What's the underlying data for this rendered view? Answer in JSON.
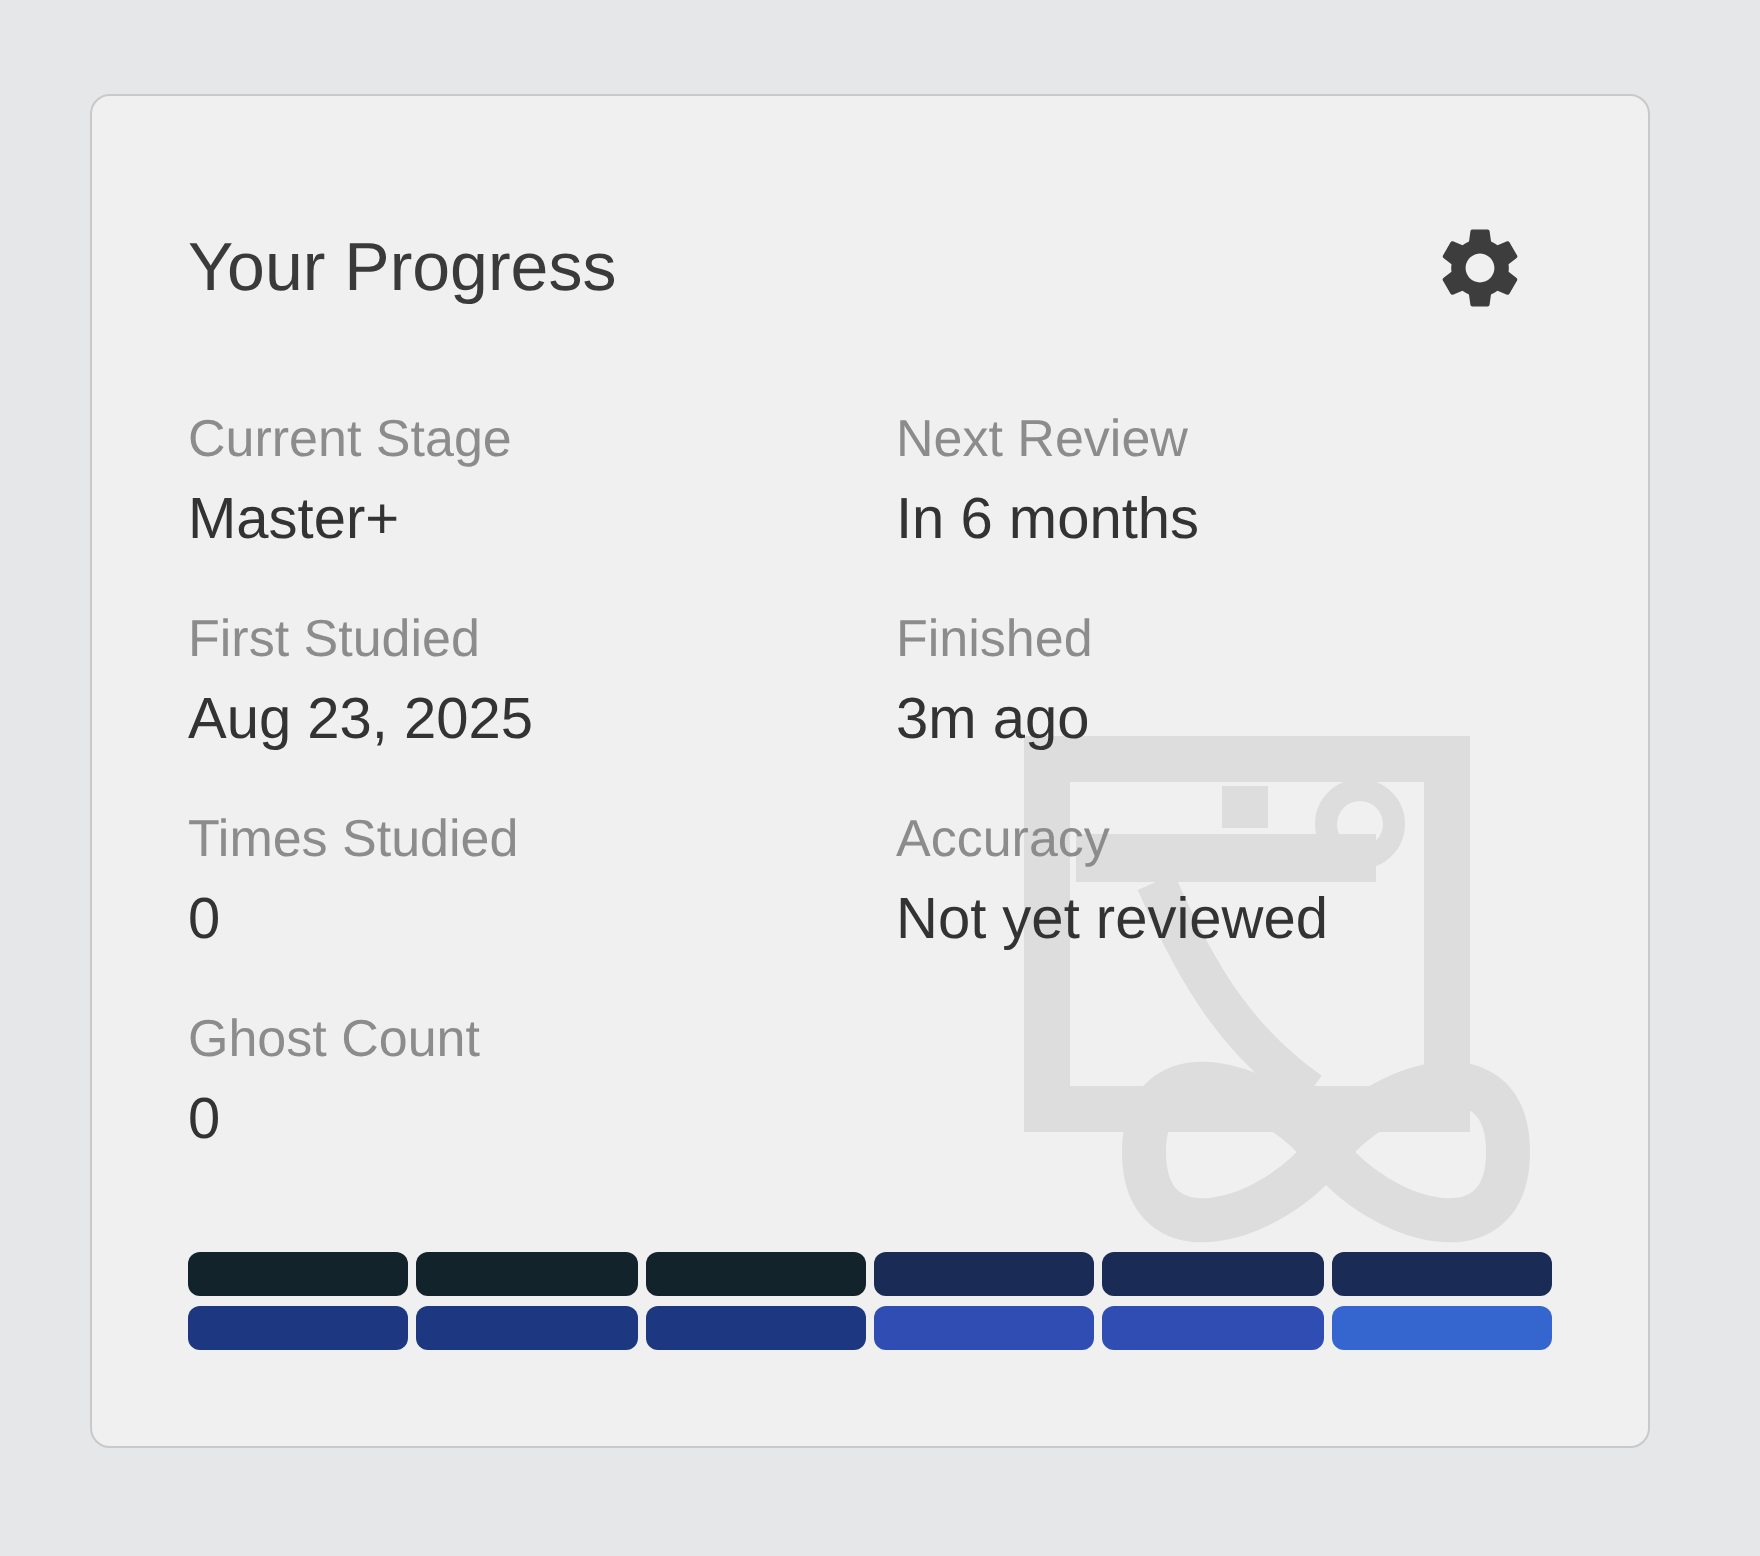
{
  "card": {
    "title": "Your Progress"
  },
  "stats": [
    {
      "label": "Current Stage",
      "value": "Master+"
    },
    {
      "label": "Next Review",
      "value": "In 6 months"
    },
    {
      "label": "First Studied",
      "value": "Aug 23, 2025"
    },
    {
      "label": "Finished",
      "value": "3m ago"
    },
    {
      "label": "Times Studied",
      "value": "0"
    },
    {
      "label": "Accuracy",
      "value": "Not yet reviewed"
    },
    {
      "label": "Ghost Count",
      "value": "0"
    }
  ],
  "stage_bars": [
    [
      {
        "color": "#12232b"
      },
      {
        "color": "#12232b"
      },
      {
        "color": "#12232b"
      },
      {
        "color": "#1a2b55"
      },
      {
        "color": "#1a2b55"
      },
      {
        "color": "#1a2b55"
      }
    ],
    [
      {
        "color": "#1d3780"
      },
      {
        "color": "#1d3780"
      },
      {
        "color": "#1d3780"
      },
      {
        "color": "#304db4"
      },
      {
        "color": "#304db4"
      },
      {
        "color": "#3566d0"
      }
    ]
  ]
}
